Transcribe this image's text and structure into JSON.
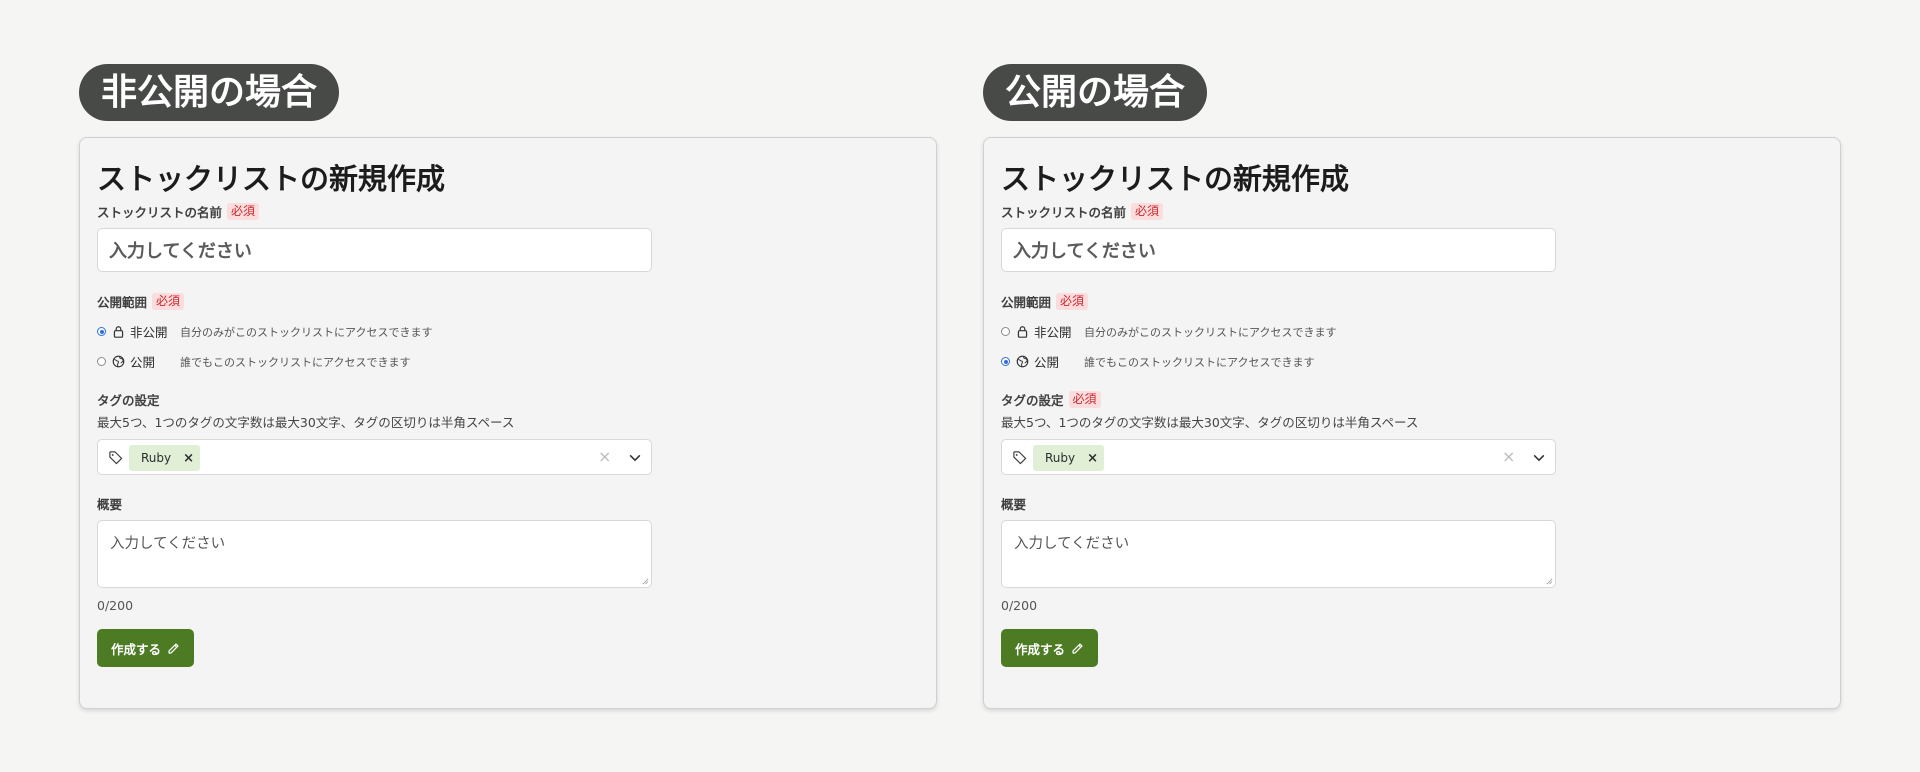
{
  "panels": [
    {
      "scenario_label": "非公開の場合",
      "form_title": "ストックリストの新規作成",
      "name_field": {
        "label": "ストックリストの名前",
        "required_badge": "必須",
        "placeholder": "入力してください"
      },
      "visibility": {
        "label": "公開範囲",
        "required_badge": "必須",
        "options": [
          {
            "label": "非公開",
            "description": "自分のみがこのストックリストにアクセスできます",
            "icon": "lock-icon",
            "checked": true
          },
          {
            "label": "公開",
            "description": "誰でもこのストックリストにアクセスできます",
            "icon": "globe-icon",
            "checked": false
          }
        ]
      },
      "tags": {
        "label": "タグの設定",
        "required_badge": "",
        "helper": "最大5つ、1つのタグの文字数は最大30文字、タグの区切りは半角スペース",
        "selected": [
          "Ruby"
        ],
        "chip_remove": "×",
        "clear_icon": "×"
      },
      "summary": {
        "label": "概要",
        "placeholder": "入力してください",
        "counter": "0/200"
      },
      "submit_label": "作成する"
    },
    {
      "scenario_label": "公開の場合",
      "form_title": "ストックリストの新規作成",
      "name_field": {
        "label": "ストックリストの名前",
        "required_badge": "必須",
        "placeholder": "入力してください"
      },
      "visibility": {
        "label": "公開範囲",
        "required_badge": "必須",
        "options": [
          {
            "label": "非公開",
            "description": "自分のみがこのストックリストにアクセスできます",
            "icon": "lock-icon",
            "checked": false
          },
          {
            "label": "公開",
            "description": "誰でもこのストックリストにアクセスできます",
            "icon": "globe-icon",
            "checked": true
          }
        ]
      },
      "tags": {
        "label": "タグの設定",
        "required_badge": "必須",
        "helper": "最大5つ、1つのタグの文字数は最大30文字、タグの区切りは半角スペース",
        "selected": [
          "Ruby"
        ],
        "chip_remove": "×",
        "clear_icon": "×"
      },
      "summary": {
        "label": "概要",
        "placeholder": "入力してください",
        "counter": "0/200"
      },
      "submit_label": "作成する"
    }
  ],
  "colors": {
    "scenario_pill_bg": "#474a47",
    "required_badge_bg": "#fcdcdc",
    "required_badge_text": "#c8282f",
    "tag_chip_bg": "#e1efd7",
    "submit_button_bg": "#4c7b23",
    "radio_checked": "#2f6fd8"
  }
}
